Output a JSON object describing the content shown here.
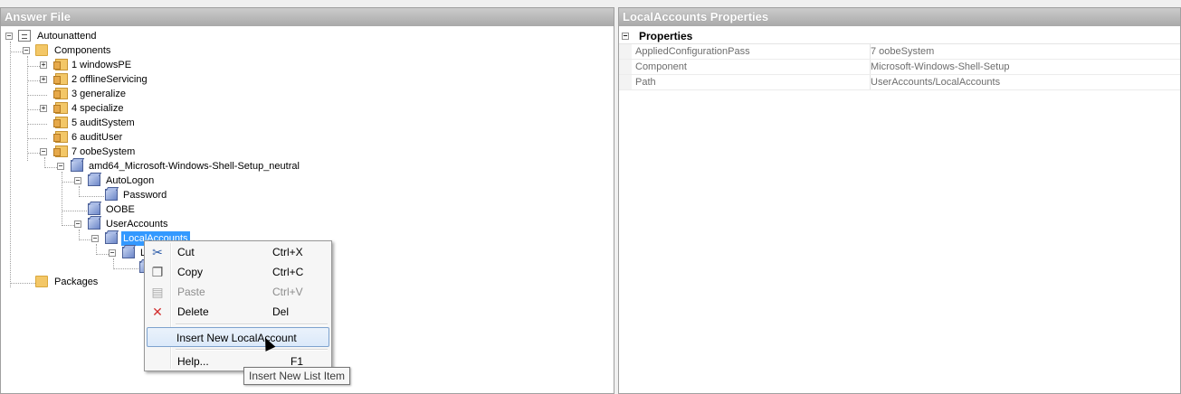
{
  "left_pane": {
    "title": "Answer File",
    "tree": {
      "root": "Autounattend",
      "components": "Components",
      "passes": [
        "1 windowsPE",
        "2 offlineServicing",
        "3 generalize",
        "4 specialize",
        "5 auditSystem",
        "6 auditUser",
        "7 oobeSystem"
      ],
      "component_node": "amd64_Microsoft-Windows-Shell-Setup_neutral",
      "autologon": "AutoLogon",
      "password": "Password",
      "oobe": "OOBE",
      "useraccounts": "UserAccounts",
      "localaccounts": "LocalAccounts",
      "child_partial": "L",
      "packages": "Packages"
    }
  },
  "right_pane": {
    "title": "LocalAccounts Properties",
    "category": "Properties",
    "rows": [
      {
        "name": "AppliedConfigurationPass",
        "value": "7 oobeSystem"
      },
      {
        "name": "Component",
        "value": "Microsoft-Windows-Shell-Setup"
      },
      {
        "name": "Path",
        "value": "UserAccounts/LocalAccounts"
      }
    ]
  },
  "context_menu": {
    "items": [
      {
        "label": "Cut",
        "shortcut": "Ctrl+X",
        "icon": "scissors-icon",
        "enabled": true
      },
      {
        "label": "Copy",
        "shortcut": "Ctrl+C",
        "icon": "copy-icon",
        "enabled": true
      },
      {
        "label": "Paste",
        "shortcut": "Ctrl+V",
        "icon": "paste-icon",
        "enabled": false
      },
      {
        "label": "Delete",
        "shortcut": "Del",
        "icon": "delete-icon",
        "enabled": true
      }
    ],
    "insert_label": "Insert New LocalAccount",
    "help_label": "Help...",
    "help_shortcut": "F1"
  },
  "tooltip": "Insert New List Item"
}
